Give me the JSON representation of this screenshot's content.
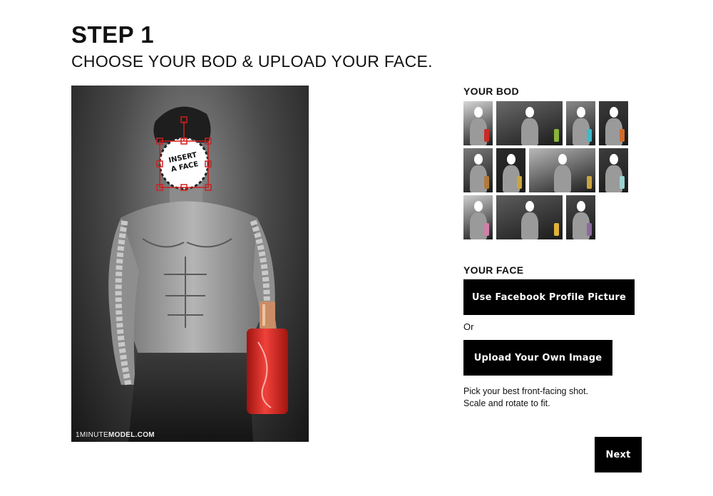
{
  "header": {
    "title": "STEP 1",
    "subtitle": "CHOOSE YOUR BOD & UPLOAD YOUR FACE."
  },
  "preview": {
    "face_placeholder_text": [
      "INSERT",
      "A FACE"
    ],
    "watermark_light": "1MINUTE",
    "watermark_bold": "MODEL.COM",
    "bottle_color": "#e3231f"
  },
  "bod_section": {
    "label": "YOUR BOD",
    "thumbnails": [
      {
        "name": "bod-1",
        "bottle": "#cc2a24"
      },
      {
        "name": "bod-2",
        "bottle": "#8bb43a"
      },
      {
        "name": "bod-3",
        "bottle": "#3fb9c9"
      },
      {
        "name": "bod-4",
        "bottle": "#d06b2a"
      },
      {
        "name": "bod-5",
        "bottle": "#b07a3a"
      },
      {
        "name": "bod-6",
        "bottle": "#c9a441"
      },
      {
        "name": "bod-7",
        "bottle": "#c9a441"
      },
      {
        "name": "bod-8",
        "bottle": "#9ad3d0"
      },
      {
        "name": "bod-9",
        "bottle": "#d07fa8"
      },
      {
        "name": "bod-10",
        "bottle": "#e0b13b"
      },
      {
        "name": "bod-11",
        "bottle": "#8a6a9c"
      },
      {
        "name": "bod-12",
        "bottle": "#6a4fa0"
      }
    ]
  },
  "face_section": {
    "label": "YOUR FACE",
    "facebook_button": "Use Facebook Profile Picture",
    "or_text": "Or",
    "upload_button": "Upload Your Own Image",
    "hint_line1": "Pick your best front-facing shot.",
    "hint_line2": "Scale and rotate to fit."
  },
  "footer": {
    "next_button": "Next"
  }
}
